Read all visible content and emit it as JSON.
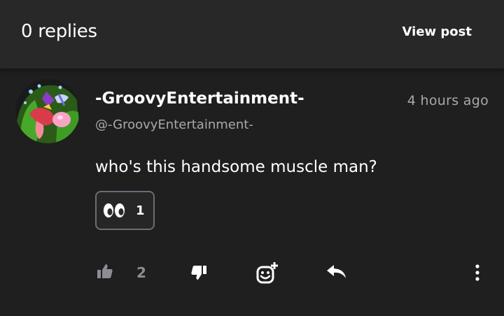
{
  "header": {
    "replies_label": "0 replies",
    "view_post_label": "View post"
  },
  "comment": {
    "author_name": "-GroovyEntertainment-",
    "author_handle": "@-GroovyEntertainment-",
    "timestamp": "4 hours ago",
    "text": "who's this handsome muscle man?",
    "reactions": [
      {
        "emoji": "eyes-emoji",
        "count": "1"
      }
    ]
  },
  "actions": {
    "like_count": "2",
    "icons": [
      "thumbs-up-icon",
      "thumbs-down-icon",
      "add-reaction-icon",
      "reply-icon",
      "more-options-icon"
    ]
  },
  "colors": {
    "background": "#1f1f1f",
    "header": "#282828",
    "muted_text": "#a9a9a9",
    "icon_muted": "#8d8d95",
    "chip_border": "#6c6c78"
  }
}
